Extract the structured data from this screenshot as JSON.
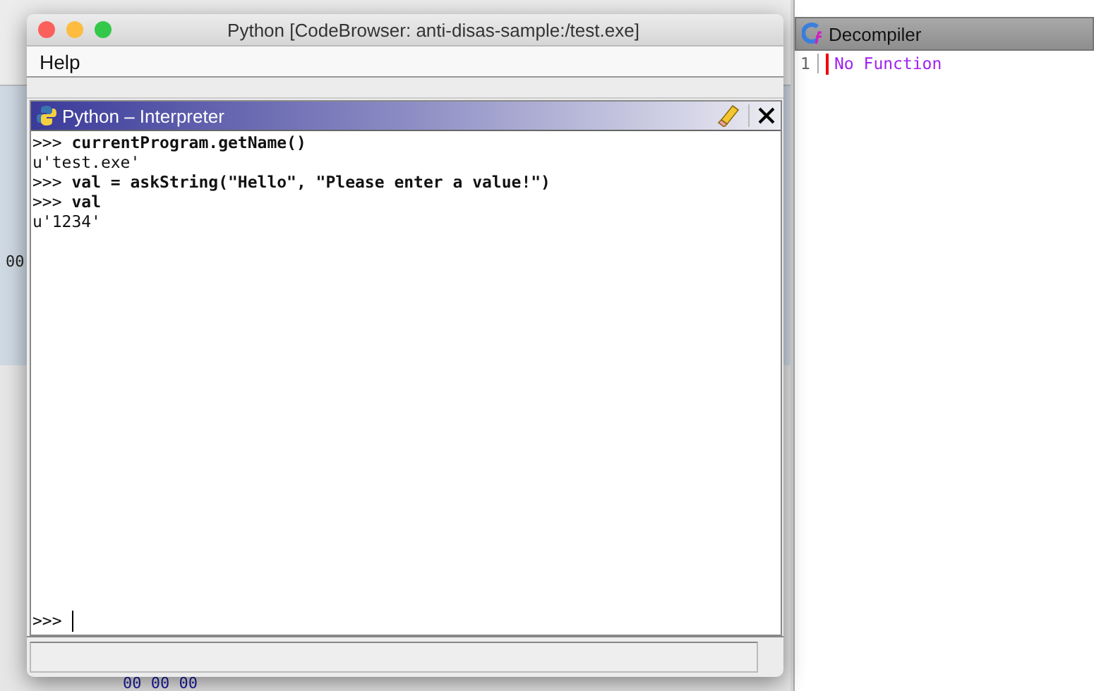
{
  "background": {
    "left_text": "00",
    "bottom_text": "00 00 00"
  },
  "decompiler": {
    "title": "Decompiler",
    "lines": [
      {
        "number": "1",
        "text": "No Function"
      }
    ]
  },
  "window": {
    "title": "Python [CodeBrowser: anti-disas-sample:/test.exe]",
    "menu": [
      "Help"
    ],
    "panel": {
      "title": "Python – Interpreter",
      "lines": [
        {
          "kind": "input",
          "prompt": ">>>",
          "text": "currentProgram.getName()"
        },
        {
          "kind": "output",
          "text": "u'test.exe'"
        },
        {
          "kind": "input",
          "prompt": ">>>",
          "text": "val = askString(\"Hello\", \"Please enter a value!\")"
        },
        {
          "kind": "input",
          "prompt": ">>>",
          "text": "val"
        },
        {
          "kind": "output",
          "text": "u'1234'"
        }
      ],
      "prompt": ">>>"
    }
  }
}
